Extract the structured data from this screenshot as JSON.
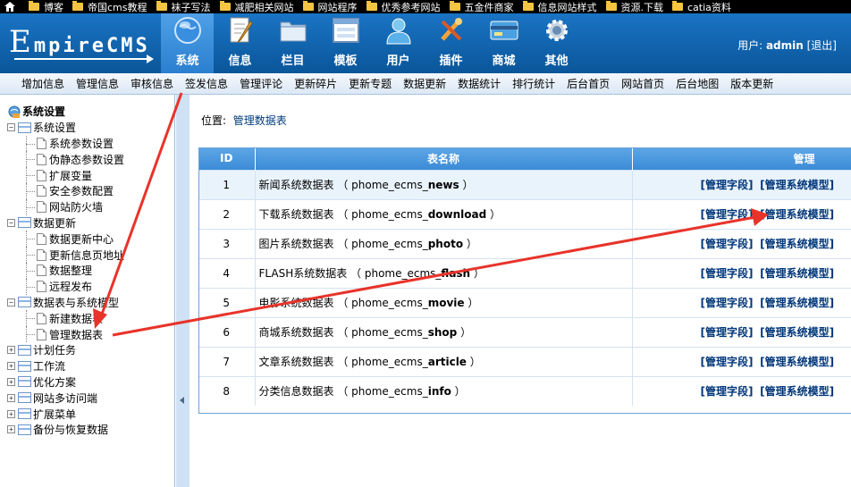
{
  "bookmarks": [
    "博客",
    "帝国cms教程",
    "袜子写法",
    "减肥相关网站",
    "网站程序",
    "优秀参考网站",
    "五金件商家",
    "信息网站样式",
    "资源.下载",
    "catia资料"
  ],
  "logo": {
    "e": "E",
    "rest": "mpireCMS"
  },
  "nav": [
    {
      "label": "系统",
      "icon": "globe-icon",
      "active": true
    },
    {
      "label": "信息",
      "icon": "document-edit-icon"
    },
    {
      "label": "栏目",
      "icon": "folder-icon"
    },
    {
      "label": "模板",
      "icon": "window-template-icon"
    },
    {
      "label": "用户",
      "icon": "user-icon"
    },
    {
      "label": "插件",
      "icon": "tools-icon"
    },
    {
      "label": "商城",
      "icon": "credit-card-icon"
    },
    {
      "label": "其他",
      "icon": "gear-icon"
    }
  ],
  "user": {
    "prefix": "用户:",
    "name": "admin",
    "logout": "[退出]"
  },
  "submenu": [
    "增加信息",
    "管理信息",
    "审核信息",
    "签发信息",
    "管理评论",
    "更新碎片",
    "更新专题",
    "数据更新",
    "数据统计",
    "排行统计",
    "后台首页",
    "网站首页",
    "后台地图",
    "版本更新"
  ],
  "tree": {
    "root": "系统设置",
    "groups": [
      {
        "label": "系统设置",
        "expanded": true,
        "items": [
          "系统参数设置",
          "伪静态参数设置",
          "扩展变量",
          "安全参数配置",
          "网站防火墙"
        ]
      },
      {
        "label": "数据更新",
        "expanded": true,
        "items": [
          "数据更新中心",
          "更新信息页地址",
          "数据整理",
          "远程发布"
        ]
      },
      {
        "label": "数据表与系统模型",
        "expanded": true,
        "items": [
          "新建数据表",
          "管理数据表"
        ]
      },
      {
        "label": "计划任务",
        "expanded": false,
        "items": []
      },
      {
        "label": "工作流",
        "expanded": false,
        "items": []
      },
      {
        "label": "优化方案",
        "expanded": false,
        "items": []
      },
      {
        "label": "网站多访问端",
        "expanded": false,
        "items": []
      },
      {
        "label": "扩展菜单",
        "expanded": false,
        "items": []
      },
      {
        "label": "备份与恢复数据",
        "expanded": false,
        "items": []
      }
    ]
  },
  "location": {
    "label": "位置:",
    "link": "管理数据表"
  },
  "table": {
    "headers": [
      "ID",
      "表名称",
      "管理"
    ],
    "rows": [
      {
        "id": "1",
        "name": "新闻系统数据表",
        "prefix": "phome_ecms_",
        "suffix": "news"
      },
      {
        "id": "2",
        "name": "下载系统数据表",
        "prefix": "phome_ecms_",
        "suffix": "download"
      },
      {
        "id": "3",
        "name": "图片系统数据表",
        "prefix": "phome_ecms_",
        "suffix": "photo"
      },
      {
        "id": "4",
        "name": "FLASH系统数据表",
        "prefix": "phome_ecms_",
        "suffix": "flash"
      },
      {
        "id": "5",
        "name": "电影系统数据表",
        "prefix": "phome_ecms_",
        "suffix": "movie"
      },
      {
        "id": "6",
        "name": "商城系统数据表",
        "prefix": "phome_ecms_",
        "suffix": "shop"
      },
      {
        "id": "7",
        "name": "文章系统数据表",
        "prefix": "phome_ecms_",
        "suffix": "article"
      },
      {
        "id": "8",
        "name": "分类信息数据表",
        "prefix": "phome_ecms_",
        "suffix": "info"
      }
    ],
    "manage_fields": "[管理字段]",
    "manage_models": "[管理系统模型]"
  },
  "colors": {
    "header": "#0a5ea8",
    "annotation": "#e8332a",
    "link": "#00367a"
  }
}
